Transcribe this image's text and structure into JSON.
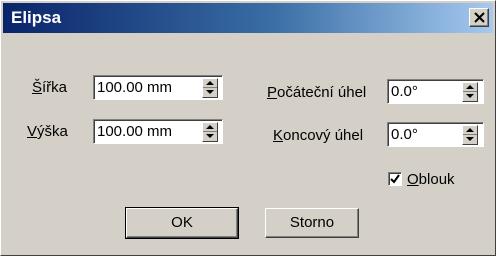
{
  "window": {
    "title": "Elipsa",
    "close_icon": "close-icon"
  },
  "fields": {
    "width": {
      "label_prefix": "",
      "label_mnemonic": "Š",
      "label_rest": "ířka",
      "value": "100.00 mm"
    },
    "height": {
      "label_prefix": "",
      "label_mnemonic": "V",
      "label_rest": "ýška",
      "value": "100.00 mm"
    },
    "start_angle": {
      "label_prefix": "",
      "label_mnemonic": "P",
      "label_rest": "očáteční úhel",
      "value": "0.0°"
    },
    "end_angle": {
      "label_prefix": "",
      "label_mnemonic": "K",
      "label_rest": "oncový úhel",
      "value": "0.0°"
    }
  },
  "arc_checkbox": {
    "checked": true,
    "label_mnemonic": "O",
    "label_rest": "blouk"
  },
  "buttons": {
    "ok": "OK",
    "cancel": "Storno"
  }
}
